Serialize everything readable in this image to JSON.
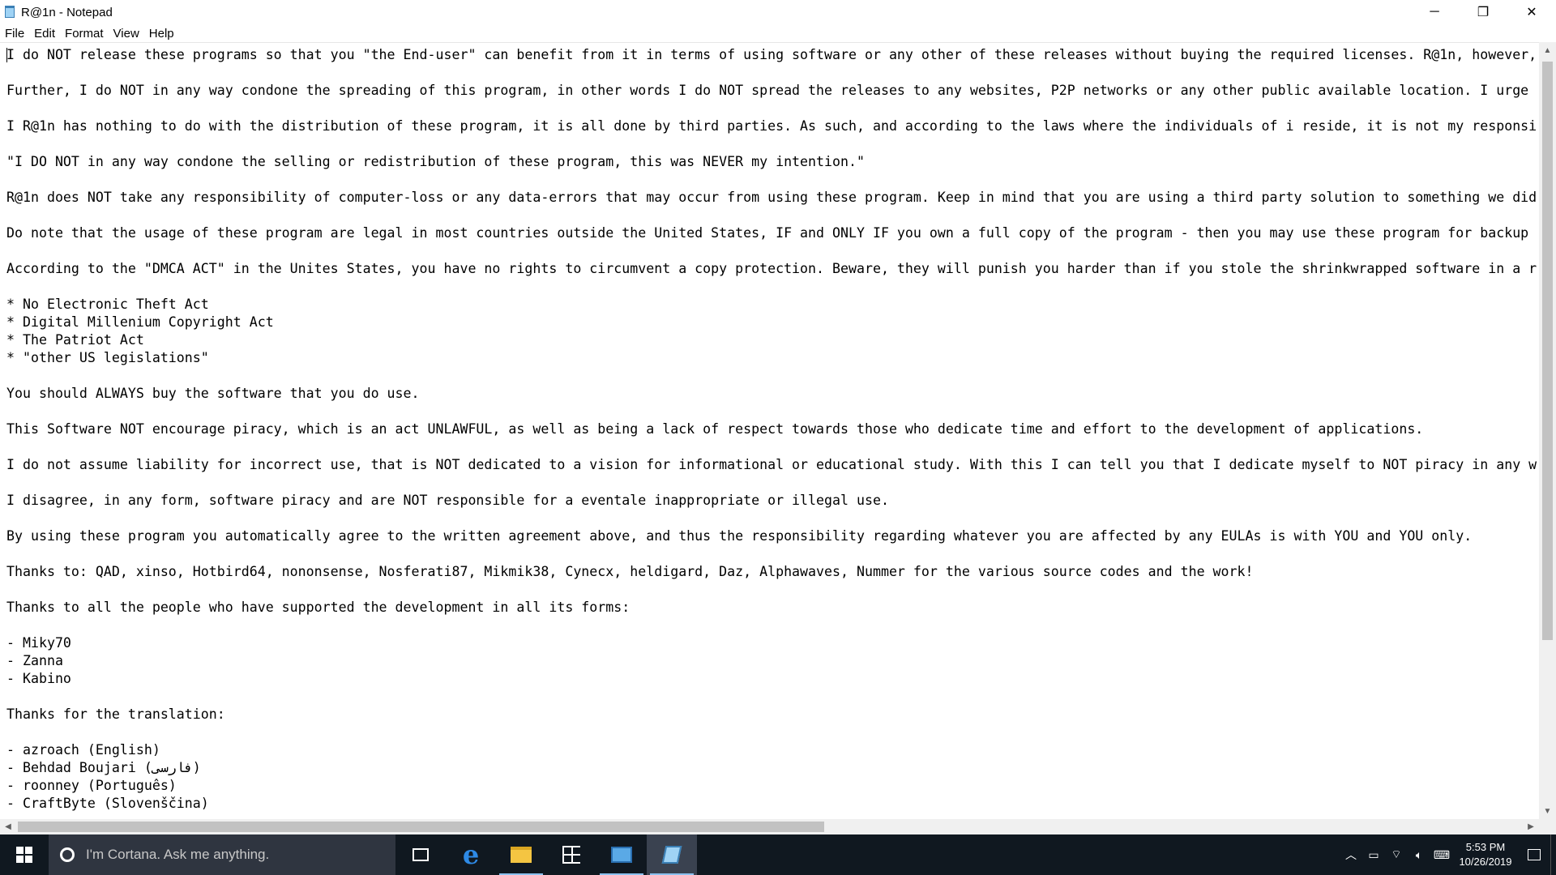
{
  "window": {
    "title": "R@1n - Notepad"
  },
  "window_buttons": {
    "minimize": "─",
    "maximize": "❐",
    "close": "✕"
  },
  "menu": [
    "File",
    "Edit",
    "Format",
    "View",
    "Help"
  ],
  "document": {
    "lines": [
      "I do NOT release these programs so that you \"the End-user\" can benefit from it in terms of using software or any other of these releases without buying the required licenses. R@1n, however,",
      "",
      "Further, I do NOT in any way condone the spreading of this program, in other words I do NOT spread the releases to any websites, P2P networks or any other public available location. I urge",
      "",
      "I R@1n has nothing to do with the distribution of these program, it is all done by third parties. As such, and according to the laws where the individuals of i reside, it is not my responsi",
      "",
      "\"I DO NOT in any way condone the selling or redistribution of these program, this was NEVER my intention.\"",
      "",
      "R@1n does NOT take any responsibility of computer-loss or any data-errors that may occur from using these program. Keep in mind that you are using a third party solution to something we did",
      "",
      "Do note that the usage of these program are legal in most countries outside the United States, IF and ONLY IF you own a full copy of the program - then you may use these program for backup",
      "",
      "According to the \"DMCA ACT\" in the Unites States, you have no rights to circumvent a copy protection. Beware, they will punish you harder than if you stole the shrinkwrapped software in a r",
      "",
      "* No Electronic Theft Act",
      "* Digital Millenium Copyright Act",
      "* The Patriot Act",
      "* \"other US legislations\"",
      "",
      "You should ALWAYS buy the software that you do use.",
      "",
      "This Software NOT encourage piracy, which is an act UNLAWFUL, as well as being a lack of respect towards those who dedicate time and effort to the development of applications.",
      "",
      "I do not assume liability for incorrect use, that is NOT dedicated to a vision for informational or educational study. With this I can tell you that I dedicate myself to NOT piracy in any w",
      "",
      "I disagree, in any form, software piracy and are NOT responsible for a eventale inappropriate or illegal use.",
      "",
      "By using these program you automatically agree to the written agreement above, and thus the responsibility regarding whatever you are affected by any EULAs is with YOU and YOU only.",
      "",
      "Thanks to: QAD, xinso, Hotbird64, nononsense, Nosferati87, Mikmik38, Cynecx, heldigard, Daz, Alphawaves, Nummer for the various source codes and the work!",
      "",
      "Thanks to all the people who have supported the development in all its forms:",
      "",
      "- Miky70",
      "- Zanna",
      "- Kabino",
      "",
      "Thanks for the translation:",
      "",
      "- azroach (English)",
      "- Behdad Boujari (فارسی)",
      "- roonney (Português)",
      "- CraftByte (Slovenščina)"
    ]
  },
  "taskbar": {
    "cortana_placeholder": "I'm Cortana. Ask me anything.",
    "apps": [
      "task-view",
      "edge",
      "file-explorer",
      "store",
      "control-panel",
      "notepad"
    ],
    "clock_time": "5:53 PM",
    "clock_date": "10/26/2019"
  },
  "colors": {
    "taskbar": "#101820",
    "cortana_box": "#2f3540",
    "scroll_thumb": "#c2c2c2"
  }
}
